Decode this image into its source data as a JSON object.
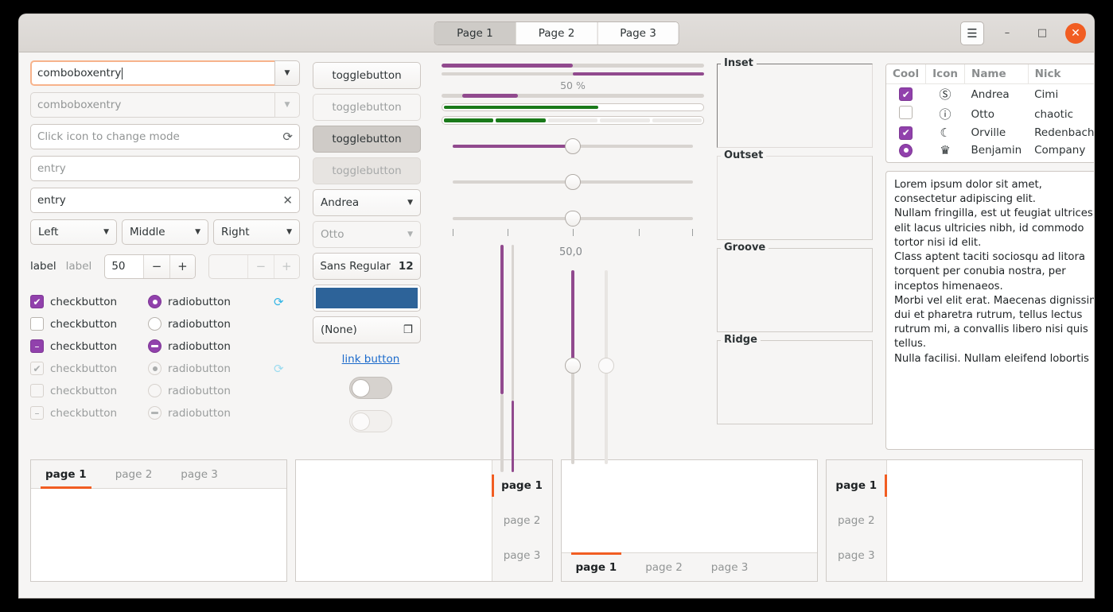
{
  "window": {
    "header": {
      "stack_tabs": [
        {
          "label": "Page 1",
          "active": true
        },
        {
          "label": "Page 2",
          "active": false
        },
        {
          "label": "Page 3",
          "active": false
        }
      ],
      "menu_icon": "hamburger-menu-icon",
      "minimize_icon": "–",
      "maximize_icon": "□",
      "close_icon": "✕",
      "close_color": "#f15d22"
    }
  },
  "entries_column": {
    "combobox_entry_active": {
      "value": "comboboxentry",
      "arrow": "▼"
    },
    "combobox_entry_disabled": {
      "placeholder": "comboboxentry",
      "arrow": "▼"
    },
    "icon_entry": {
      "placeholder": "Click icon to change mode",
      "icon": "refresh-icon",
      "icon_glyph": "⟳"
    },
    "plain_entry": {
      "placeholder": "entry"
    },
    "clear_entry": {
      "value": "entry",
      "icon": "clear-icon",
      "icon_glyph": "✕"
    },
    "combos": [
      {
        "label": "Left",
        "arrow": "▼"
      },
      {
        "label": "Middle",
        "arrow": "▼"
      },
      {
        "label": "Right",
        "arrow": "▼"
      }
    ],
    "label_row": {
      "label_normal": "label",
      "label_dim": "label",
      "spin_value": "50",
      "minus": "−",
      "plus": "+",
      "spin_disabled_value": "",
      "minus_dim": "−",
      "plus_dim": "+"
    },
    "check_rows": [
      {
        "check_label": "checkbutton",
        "check_state": "on",
        "radio_label": "radiobutton",
        "radio_state": "on",
        "dim": false,
        "spinner": true
      },
      {
        "check_label": "checkbutton",
        "check_state": "off",
        "radio_label": "radiobutton",
        "radio_state": "off",
        "dim": false,
        "spinner": false
      },
      {
        "check_label": "checkbutton",
        "check_state": "mixed",
        "radio_label": "radiobutton",
        "radio_state": "mixed",
        "dim": false,
        "spinner": false
      },
      {
        "check_label": "checkbutton",
        "check_state": "on",
        "radio_label": "radiobutton",
        "radio_state": "on",
        "dim": true,
        "spinner": true
      },
      {
        "check_label": "checkbutton",
        "check_state": "off",
        "radio_label": "radiobutton",
        "radio_state": "off",
        "dim": true,
        "spinner": false
      },
      {
        "check_label": "checkbutton",
        "check_state": "mixed",
        "radio_label": "radiobutton",
        "radio_state": "mixed",
        "dim": true,
        "spinner": false
      }
    ],
    "check_glyph": "✔",
    "mixed_glyph": "–",
    "spinner_glyph": "⟳"
  },
  "buttons_column": {
    "toggles": [
      {
        "label": "togglebutton",
        "state": "normal"
      },
      {
        "label": "togglebutton",
        "state": "disabled"
      },
      {
        "label": "togglebutton",
        "state": "active"
      },
      {
        "label": "togglebutton",
        "state": "active-disabled"
      }
    ],
    "combo_enabled": {
      "label": "Andrea",
      "arrow": "▼"
    },
    "combo_disabled": {
      "label": "Otto",
      "arrow": "▼"
    },
    "font_button": {
      "family": "Sans Regular",
      "size": "12"
    },
    "color_button": {
      "color": "#2d6399"
    },
    "file_button": {
      "label": "(None)",
      "icon": "file-copy-icon",
      "icon_glyph": "❐"
    },
    "link_button": {
      "label": "link button"
    },
    "switches": [
      {
        "state": "off",
        "disabled": false
      },
      {
        "state": "off",
        "disabled": true
      }
    ]
  },
  "bars_column": {
    "progress_ltr": {
      "value": 50
    },
    "progress_rtl": {
      "value": 50
    },
    "percent_label": "50 %",
    "progress_pulse": {
      "start": 8,
      "width": 21
    },
    "levelbar_continuous": {
      "value": 60
    },
    "levelbar_discrete": {
      "segments": 5,
      "filled": 2
    },
    "scale_with_fill": {
      "value": 50
    },
    "scale_plain": {
      "value": 50
    },
    "scale_marks": {
      "value": 50,
      "marks": [
        0,
        25,
        50,
        75,
        100
      ]
    },
    "vscale_value_label": "50,0",
    "vertical_scales": [
      {
        "name": "vscale-left-filled",
        "value": 50
      },
      {
        "name": "vscale-left-thin",
        "value": 50
      },
      {
        "name": "vscale-right-filled",
        "value": 50
      },
      {
        "name": "vscale-right-empty",
        "value": 50
      }
    ],
    "colors": {
      "accent": "#914a8e",
      "level": "#1a7a1a",
      "trough": "#d8d4d0"
    }
  },
  "frames_column": {
    "frames": [
      {
        "label": "Inset"
      },
      {
        "label": "Outset"
      },
      {
        "label": "Groove"
      },
      {
        "label": "Ridge"
      }
    ]
  },
  "treeview": {
    "columns": [
      "Cool",
      "Icon",
      "Name",
      "Nick"
    ],
    "rows": [
      {
        "cool": "checked",
        "icon": "check-circle-icon",
        "icon_glyph": "✔",
        "name": "Andrea",
        "nick": "Cimi"
      },
      {
        "cool": "unchecked",
        "icon": "warning-circle-icon",
        "icon_glyph": "!",
        "name": "Otto",
        "nick": "chaotic"
      },
      {
        "cool": "checked",
        "icon": "moon-face-icon",
        "icon_glyph": "☾",
        "name": "Orville",
        "nick": "Redenbacher"
      },
      {
        "cool": "radio-on",
        "icon": "monkey-face-icon",
        "icon_glyph": "♛",
        "name": "Benjamin",
        "nick": "Company"
      }
    ]
  },
  "textview": {
    "text": "Lorem ipsum dolor sit amet, consectetur adipiscing elit.\nNullam fringilla, est ut feugiat ultrices, elit lacus ultricies nibh, id commodo tortor nisi id elit.\nClass aptent taciti sociosqu ad litora torquent per conubia nostra, per inceptos himenaeos.\nMorbi vel elit erat. Maecenas dignissim, dui et pharetra rutrum, tellus lectus rutrum mi, a convallis libero nisi quis tellus.\nNulla facilisi. Nullam eleifend lobortis"
  },
  "notebooks": [
    {
      "name": "notebook-tabs-top",
      "position": "top",
      "tabs": [
        {
          "label": "page 1",
          "active": true
        },
        {
          "label": "page 2",
          "active": false
        },
        {
          "label": "page 3",
          "active": false
        }
      ]
    },
    {
      "name": "notebook-tabs-right",
      "position": "right",
      "tabs": [
        {
          "label": "page 1",
          "active": true
        },
        {
          "label": "page 2",
          "active": false
        },
        {
          "label": "page 3",
          "active": false
        }
      ]
    },
    {
      "name": "notebook-tabs-bottom",
      "position": "bottom",
      "tabs": [
        {
          "label": "page 1",
          "active": true
        },
        {
          "label": "page 2",
          "active": false
        },
        {
          "label": "page 3",
          "active": false
        }
      ]
    },
    {
      "name": "notebook-tabs-left",
      "position": "left",
      "tabs": [
        {
          "label": "page 1",
          "active": true
        },
        {
          "label": "page 2",
          "active": false
        },
        {
          "label": "page 3",
          "active": false
        }
      ]
    }
  ]
}
